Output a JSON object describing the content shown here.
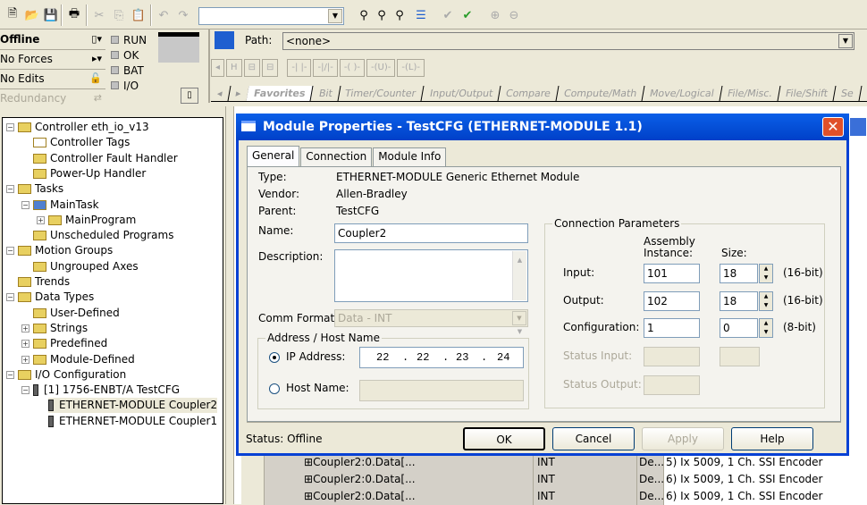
{
  "toolbar": {
    "buttons": [
      {
        "name": "new-file-icon",
        "glyph": "🗎",
        "enabled": true
      },
      {
        "name": "open-folder-icon",
        "glyph": "📂",
        "enabled": true
      },
      {
        "name": "save-icon",
        "glyph": "💾",
        "enabled": true
      },
      {
        "name": "print-icon",
        "glyph": "🖶",
        "enabled": true
      },
      {
        "name": "cut-icon",
        "glyph": "✂",
        "enabled": false
      },
      {
        "name": "copy-icon",
        "glyph": "⎘",
        "enabled": false
      },
      {
        "name": "paste-icon",
        "glyph": "📋",
        "enabled": false
      },
      {
        "name": "undo-icon",
        "glyph": "↶",
        "enabled": false
      },
      {
        "name": "redo-icon",
        "glyph": "↷",
        "enabled": false
      }
    ],
    "search_combo_value": "",
    "right_buttons": [
      {
        "name": "find-icon",
        "glyph": "⚲",
        "enabled": true
      },
      {
        "name": "find-previous-icon",
        "glyph": "⚲",
        "enabled": true
      },
      {
        "name": "find-crossref-icon",
        "glyph": "⚲",
        "enabled": true
      },
      {
        "name": "show-tree-icon",
        "glyph": "☰",
        "enabled": true
      },
      {
        "name": "verify-routine-icon",
        "glyph": "✔",
        "enabled": false
      },
      {
        "name": "verify-controller-icon",
        "glyph": "✔",
        "enabled": true
      },
      {
        "name": "zoom-in-icon",
        "glyph": "⊕",
        "enabled": false
      },
      {
        "name": "zoom-out-icon",
        "glyph": "⊖",
        "enabled": false
      }
    ]
  },
  "status": {
    "mode": "Offline",
    "forces": "No Forces",
    "edits": "No Edits",
    "redundancy": "Redundancy",
    "leds": [
      "RUN",
      "OK",
      "BAT",
      "I/O"
    ]
  },
  "path": {
    "label": "Path:",
    "value": "<none>"
  },
  "ladder_buttons": [
    "H",
    "⊟",
    "⊟",
    "-| |-",
    "-|/|-",
    "-( )-",
    "-(U)-",
    "-(L)-"
  ],
  "instruction_tabs": [
    "Favorites",
    "Bit",
    "Timer/Counter",
    "Input/Output",
    "Compare",
    "Compute/Math",
    "Move/Logical",
    "File/Misc.",
    "File/Shift",
    "Se"
  ],
  "tree": {
    "nodes": [
      {
        "label": "Controller eth_io_v13",
        "level": 0,
        "expander": "-",
        "icon": "folder"
      },
      {
        "label": "Controller Tags",
        "level": 1,
        "expander": "",
        "icon": "tags"
      },
      {
        "label": "Controller Fault Handler",
        "level": 1,
        "expander": "",
        "icon": "folder"
      },
      {
        "label": "Power-Up Handler",
        "level": 1,
        "expander": "",
        "icon": "folder"
      },
      {
        "label": "Tasks",
        "level": 0,
        "expander": "-",
        "icon": "folder"
      },
      {
        "label": "MainTask",
        "level": 1,
        "expander": "-",
        "icon": "task"
      },
      {
        "label": "MainProgram",
        "level": 2,
        "expander": "+",
        "icon": "program"
      },
      {
        "label": "Unscheduled Programs",
        "level": 1,
        "expander": "",
        "icon": "folder"
      },
      {
        "label": "Motion Groups",
        "level": 0,
        "expander": "-",
        "icon": "folder"
      },
      {
        "label": "Ungrouped Axes",
        "level": 1,
        "expander": "",
        "icon": "folder"
      },
      {
        "label": "Trends",
        "level": 0,
        "expander": "",
        "icon": "folder"
      },
      {
        "label": "Data Types",
        "level": 0,
        "expander": "-",
        "icon": "folder"
      },
      {
        "label": "User-Defined",
        "level": 1,
        "expander": "",
        "icon": "datatype"
      },
      {
        "label": "Strings",
        "level": 1,
        "expander": "+",
        "icon": "datatype"
      },
      {
        "label": "Predefined",
        "level": 1,
        "expander": "+",
        "icon": "datatype"
      },
      {
        "label": "Module-Defined",
        "level": 1,
        "expander": "+",
        "icon": "datatype"
      },
      {
        "label": "I/O Configuration",
        "level": 0,
        "expander": "-",
        "icon": "folder"
      },
      {
        "label": "[1] 1756-ENBT/A TestCFG",
        "level": 1,
        "expander": "-",
        "icon": "module"
      },
      {
        "label": "ETHERNET-MODULE Coupler2",
        "level": 2,
        "expander": "",
        "icon": "module",
        "selected": true
      },
      {
        "label": "ETHERNET-MODULE Coupler1",
        "level": 2,
        "expander": "",
        "icon": "module"
      }
    ]
  },
  "grid_rows": [
    {
      "name": "Coupler2:0.Data[...",
      "type": "INT",
      "style": "De...",
      "desc": "5) Ix 5009, 1 Ch. SSI Encoder"
    },
    {
      "name": "Coupler2:0.Data[...",
      "type": "INT",
      "style": "De...",
      "desc": "6) Ix 5009, 1 Ch. SSI Encoder"
    },
    {
      "name": "Coupler2:0.Data[...",
      "type": "INT",
      "style": "De...",
      "desc": "6) Ix 5009, 1 Ch. SSI Encoder"
    }
  ],
  "dialog": {
    "title": "Module Properties  - TestCFG (ETHERNET-MODULE 1.1)",
    "close_glyph": "✕",
    "tabs": [
      "General",
      "Connection",
      "Module Info"
    ],
    "active_tab": "General",
    "type_label": "Type:",
    "type_value": "ETHERNET-MODULE Generic Ethernet Module",
    "vendor_label": "Vendor:",
    "vendor_value": "Allen-Bradley",
    "parent_label": "Parent:",
    "parent_value": "TestCFG",
    "name_label": "Name:",
    "name_value": "Coupler2",
    "description_label": "Description:",
    "description_value": "",
    "comm_format_label": "Comm Format:",
    "comm_format_value": "Data - INT",
    "address_group": "Address / Host Name",
    "ip_label": "IP Address:",
    "ip_octets": [
      "22",
      "22",
      "23",
      "24"
    ],
    "ip_selected": true,
    "hostname_label": "Host Name:",
    "hostname_value": "",
    "conn_group": "Connection Parameters",
    "col_assembly_1": "Assembly",
    "col_assembly_2": "Instance:",
    "col_size": "Size:",
    "params": [
      {
        "label": "Input:",
        "instance": "101",
        "size": "18",
        "unit": "(16-bit)",
        "enabled": true
      },
      {
        "label": "Output:",
        "instance": "102",
        "size": "18",
        "unit": "(16-bit)",
        "enabled": true
      },
      {
        "label": "Configuration:",
        "instance": "1",
        "size": "0",
        "unit": "(8-bit)",
        "enabled": true
      },
      {
        "label": "Status Input:",
        "instance": "",
        "size": "",
        "unit": "",
        "enabled": false
      },
      {
        "label": "Status Output:",
        "instance": "",
        "size": "",
        "unit": "",
        "enabled": false
      }
    ],
    "status_text": "Status:  Offline",
    "buttons": {
      "ok": "OK",
      "cancel": "Cancel",
      "apply": "Apply",
      "help": "Help"
    }
  }
}
